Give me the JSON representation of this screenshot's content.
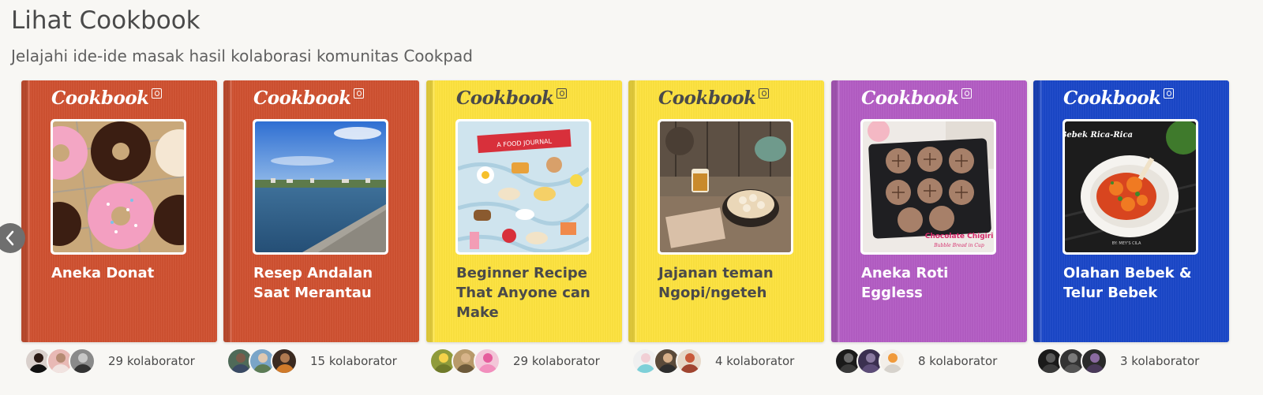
{
  "header": {
    "title": "Lihat Cookbook",
    "subtitle": "Jelajahi ide-ide masak hasil kolaborasi komunitas Cookpad"
  },
  "carousel": {
    "prev_icon": "chevron-left-icon",
    "logo_text": "Cookbook",
    "books": [
      {
        "title": "Aneka Donat",
        "collaborators": "29 kolaborator",
        "color": "#cf5131",
        "text_color": "#ffffff"
      },
      {
        "title": "Resep Andalan Saat Merantau",
        "collaborators": "15 kolaborator",
        "color": "#cf5131",
        "text_color": "#ffffff"
      },
      {
        "title": "Beginner Recipe That Anyone can Make",
        "collaborators": "29 kolaborator",
        "color": "#fde23f",
        "text_color": "#4a4a4a"
      },
      {
        "title": "Jajanan teman Ngopi/ngeteh",
        "collaborators": "4 kolaborator",
        "color": "#fde23f",
        "text_color": "#4a4a4a"
      },
      {
        "title": "Aneka Roti Eggless",
        "collaborators": "8 kolaborator",
        "color": "#b35dc4",
        "text_color": "#ffffff"
      },
      {
        "title": "Olahan Bebek & Telur Bebek",
        "collaborators": "3 kolaborator",
        "color": "#1b47c8",
        "text_color": "#ffffff"
      }
    ],
    "photo_captions": {
      "food_journal": "A FOOD JOURNAL",
      "bebek": "Bebek Rica-Rica",
      "bebek_credit": "BY: MEY'S CILA",
      "chigiri": "Chocolate Chigiri",
      "chigiri_sub": "Bubble Bread in Cup"
    }
  }
}
